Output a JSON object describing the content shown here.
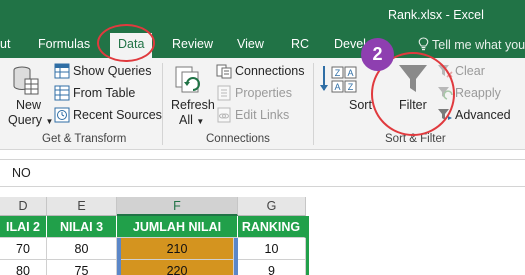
{
  "window": {
    "title": "Rank.xlsx  -  Excel"
  },
  "tabs": [
    {
      "label": "ut"
    },
    {
      "label": "Formulas"
    },
    {
      "label": "Data",
      "active": true
    },
    {
      "label": "Review"
    },
    {
      "label": "View"
    },
    {
      "label": "RC"
    },
    {
      "label": "Devel"
    }
  ],
  "tell_me": "Tell me what you",
  "ribbon": {
    "get_transform": {
      "new_query": "New",
      "new_query_line2": "Query",
      "show_queries": "Show Queries",
      "from_table": "From Table",
      "recent_sources": "Recent Sources",
      "label": "Get & Transform"
    },
    "connections": {
      "refresh": "Refresh",
      "refresh_line2": "All",
      "connections": "Connections",
      "properties": "Properties",
      "edit_links": "Edit Links",
      "label": "Connections"
    },
    "sort_filter": {
      "sort": "Sort",
      "filter": "Filter",
      "clear": "Clear",
      "reapply": "Reapply",
      "advanced": "Advanced",
      "label": "Sort & Filter"
    }
  },
  "formula_bar": {
    "name_box": "NO"
  },
  "sheet": {
    "column_headers": [
      "D",
      "E",
      "F",
      "G"
    ],
    "selected_column": "F",
    "header_row": [
      "ILAI 2",
      "NILAI 3",
      "JUMLAH NILAI",
      "RANKING"
    ],
    "rows": [
      [
        "70",
        "80",
        "210",
        "10"
      ],
      [
        "80",
        "75",
        "220",
        "9"
      ]
    ]
  },
  "annotation": {
    "step_number": "2"
  },
  "colors": {
    "excel_green": "#217346",
    "table_header_green": "#21a04a",
    "highlight_orange": "#d4941f",
    "annotation_red": "#e03a3e",
    "badge_purple": "#8e3fb0"
  }
}
